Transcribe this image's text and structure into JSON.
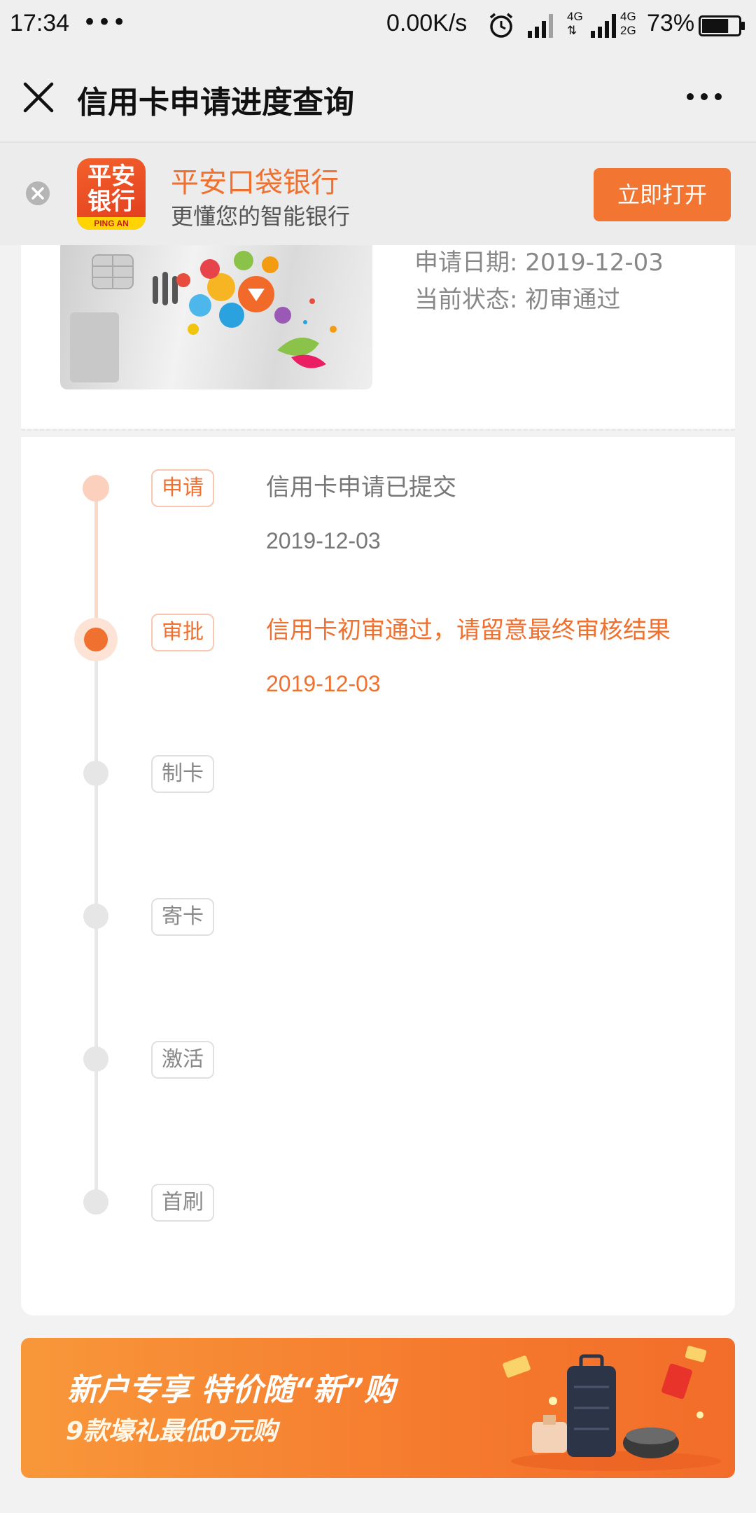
{
  "status_bar": {
    "time": "17:34",
    "dots": "•••",
    "net_speed": "0.00K/s",
    "net1_top": "4G",
    "net2_top": "4G",
    "net2_bottom": "2G",
    "battery": "73%",
    "battery_level": 0.73
  },
  "nav": {
    "title": "信用卡申请进度查询"
  },
  "app_banner": {
    "logo_line1": "平安",
    "logo_line2": "银行",
    "logo_brand": "PING AN",
    "name": "平安口袋银行",
    "desc": "更懂您的智能银行",
    "open_label": "立即打开"
  },
  "card_info": {
    "apply_date": "申请日期: 2019-12-03",
    "current_status": "当前状态: 初审通过"
  },
  "timeline": {
    "steps": [
      {
        "tag": "申请",
        "text": "信用卡申请已提交",
        "date": "2019-12-03"
      },
      {
        "tag": "审批",
        "text": "信用卡初审通过，请留意最终审核结果",
        "date": "2019-12-03"
      },
      {
        "tag": "制卡"
      },
      {
        "tag": "寄卡"
      },
      {
        "tag": "激活"
      },
      {
        "tag": "首刷"
      }
    ]
  },
  "promo": {
    "title": "新户专享 特价随“新”购",
    "subtitle": "9款壕礼最低0元购"
  },
  "colors": {
    "accent": "#f07030",
    "button": "#f27632",
    "text_gray": "#888888"
  }
}
